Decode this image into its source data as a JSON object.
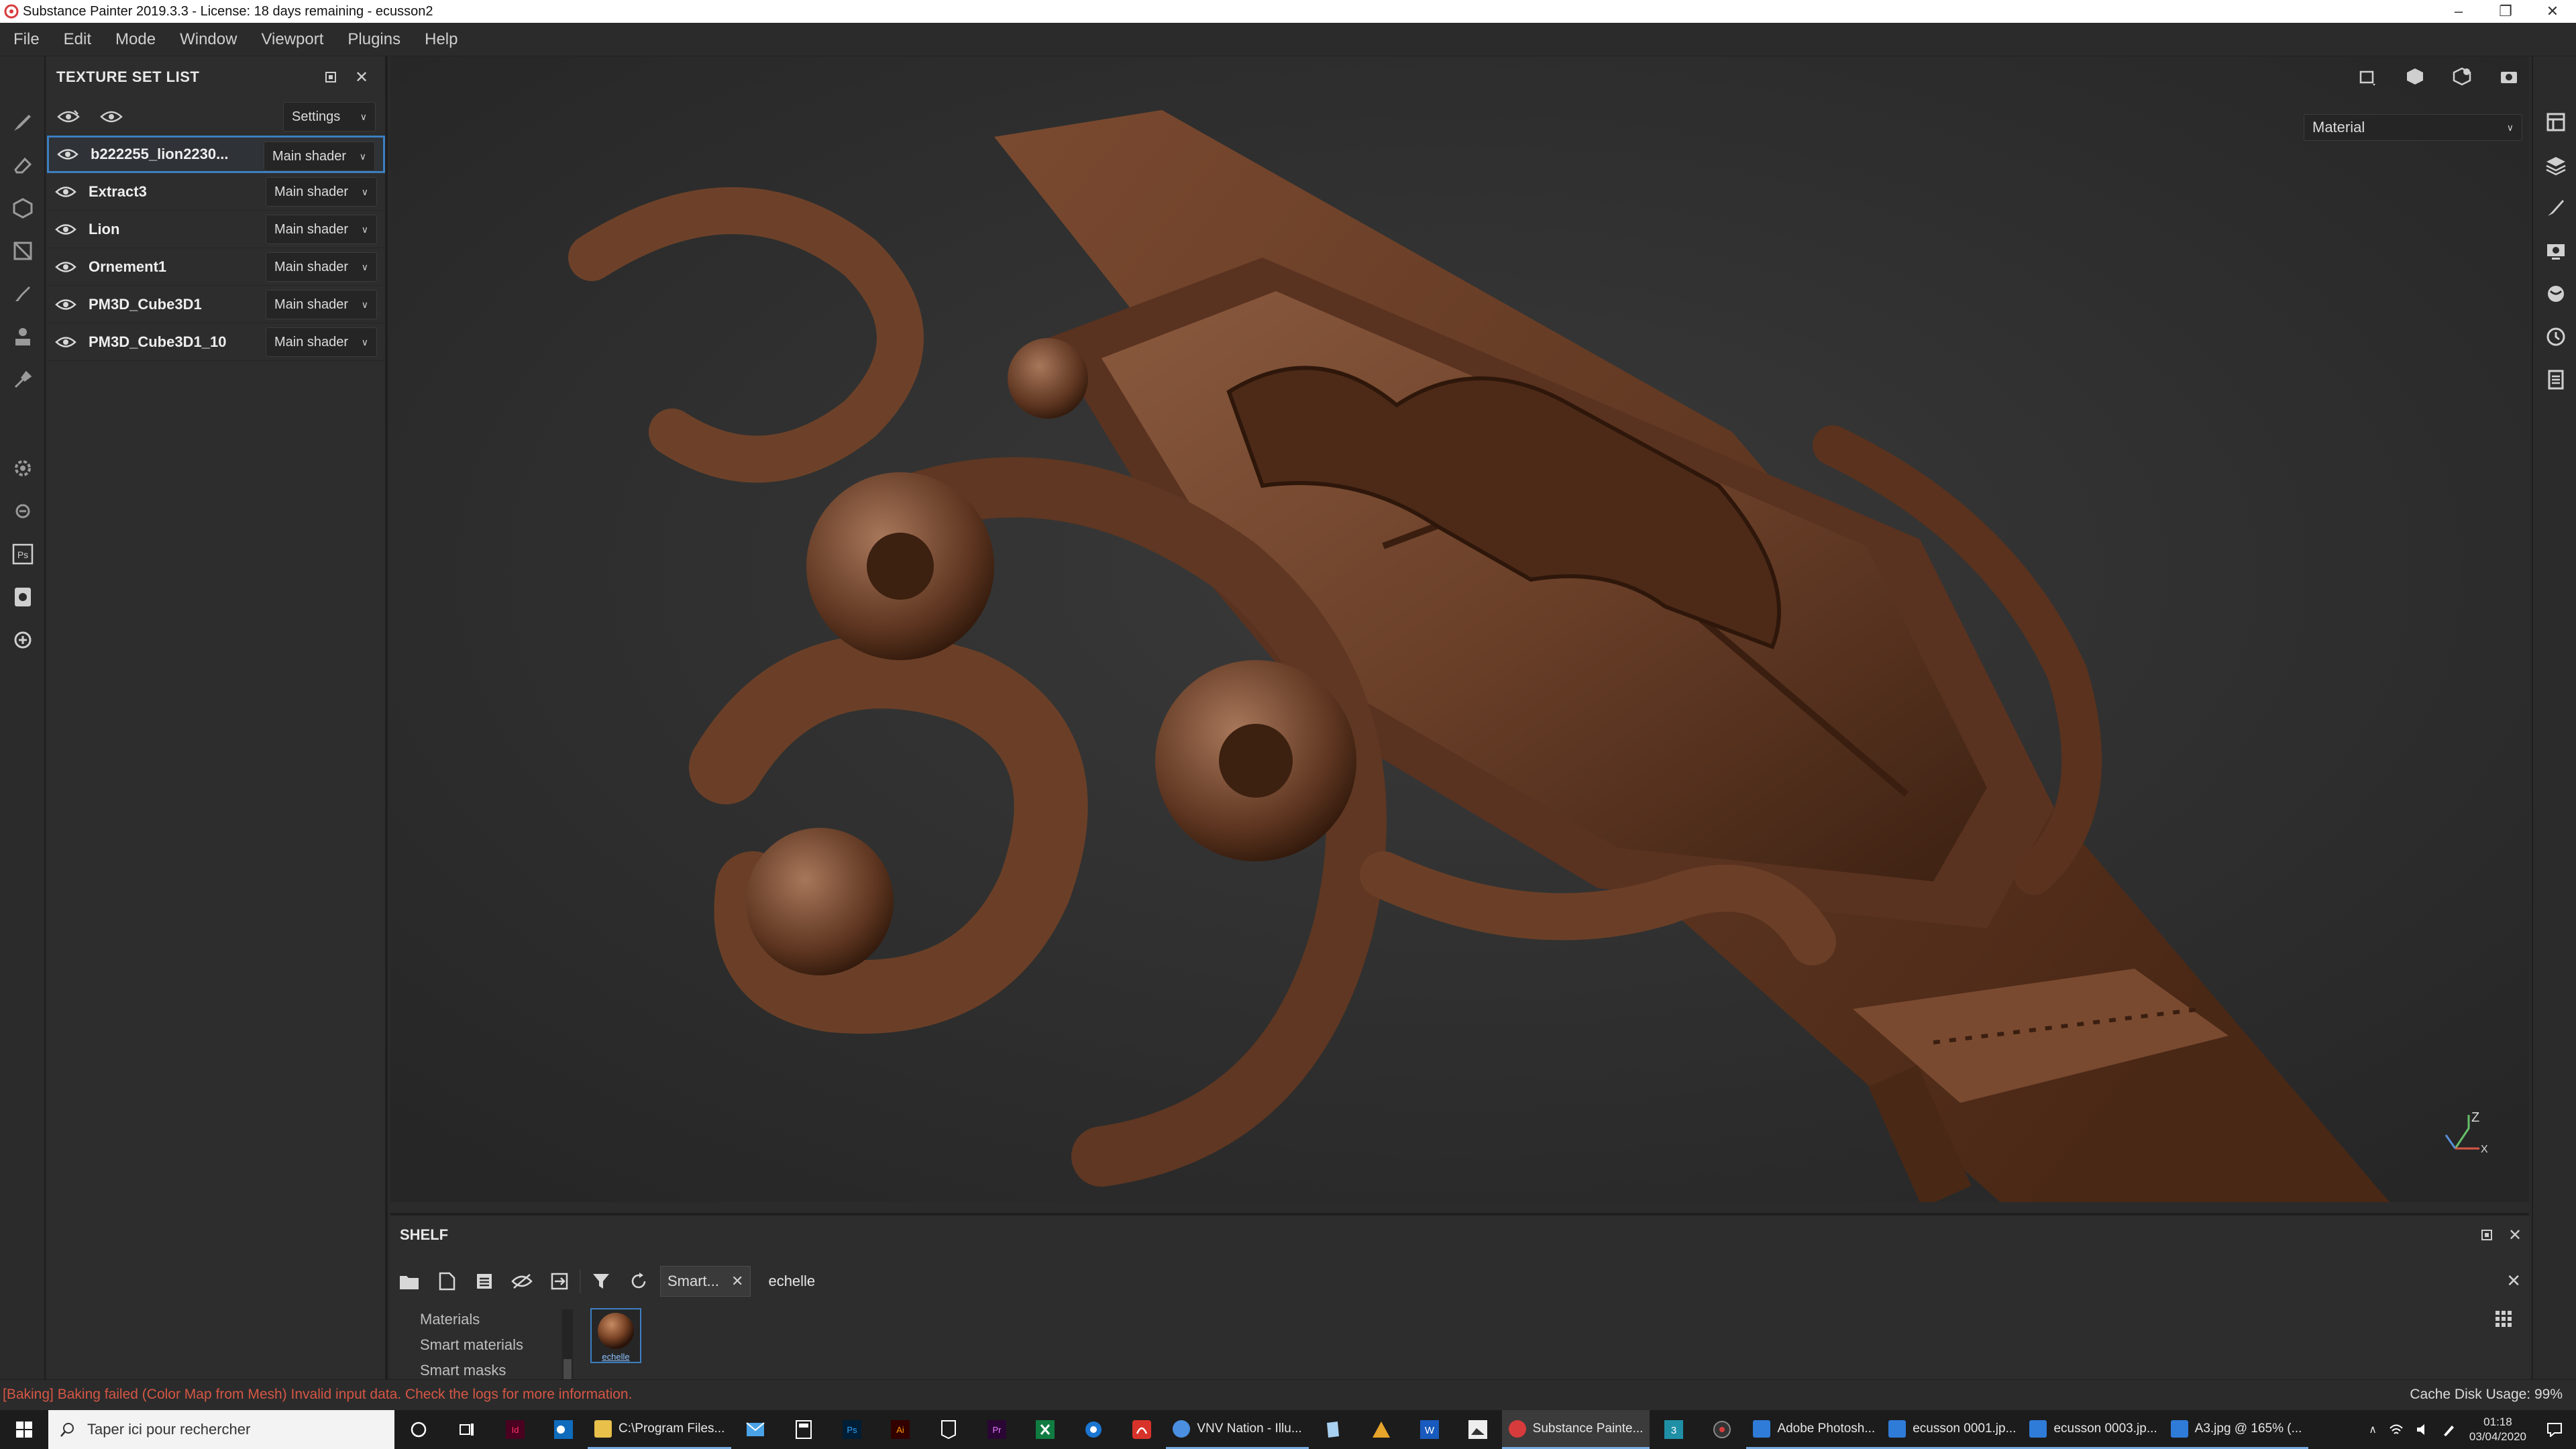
{
  "window": {
    "title": "Substance Painter 2019.3.3 - License: 18 days remaining - ecusson2",
    "controls": [
      "–",
      "❐",
      "✕"
    ]
  },
  "menu": [
    "File",
    "Edit",
    "Mode",
    "Window",
    "Viewport",
    "Plugins",
    "Help"
  ],
  "left_tools": [
    "paint-brush-icon",
    "eraser-icon",
    "projection-icon",
    "polygon-fill-icon",
    "smudge-icon",
    "clone-icon",
    "color-picker-icon",
    "settings-gear-icon",
    "bake-icon",
    "photoshop-export-icon",
    "iray-icon",
    "plugin-icon"
  ],
  "texture_set_list": {
    "title": "TEXTURE SET LIST",
    "settings_label": "Settings",
    "rows": [
      {
        "name": "b222255_lion2230...",
        "shader": "Main shader",
        "selected": true
      },
      {
        "name": "Extract3",
        "shader": "Main shader",
        "selected": false
      },
      {
        "name": "Lion",
        "shader": "Main shader",
        "selected": false
      },
      {
        "name": "Ornement1",
        "shader": "Main shader",
        "selected": false
      },
      {
        "name": "PM3D_Cube3D1",
        "shader": "Main shader",
        "selected": false
      },
      {
        "name": "PM3D_Cube3D1_10",
        "shader": "Main shader",
        "selected": false
      }
    ]
  },
  "viewport": {
    "display_mode": "Material",
    "axis_labels": {
      "z": "Z",
      "x": "X"
    }
  },
  "shelf": {
    "title": "SHELF",
    "filter_chip": "Smart...",
    "search_text": "echelle",
    "categories": [
      "Materials",
      "Smart materials",
      "Smart masks"
    ],
    "asset": {
      "label": "echelle"
    }
  },
  "status": {
    "message": "[Baking] Baking failed (Color Map from Mesh) Invalid input data. Check the logs for more information.",
    "cache": "Cache Disk Usage: 99%",
    "error_color": "#d65745"
  },
  "taskbar": {
    "search_placeholder": "Taper ici pour rechercher",
    "apps": [
      {
        "label": "C:\\Program Files...",
        "color": "#e8c04a"
      },
      {
        "label": "VNV Nation - Illu...",
        "color": "#4a8fe0"
      },
      {
        "label": "Substance Painte...",
        "color": "#d83b3b"
      },
      {
        "label": "Adobe Photosh...",
        "color": "#2f7bd8"
      },
      {
        "label": "ecusson 0001.jp...",
        "color": "#2f7bd8"
      },
      {
        "label": "ecusson 0003.jp...",
        "color": "#2f7bd8"
      },
      {
        "label": "A3.jpg @ 165% (...",
        "color": "#2f7bd8"
      }
    ],
    "time": "01:18",
    "date": "03/04/2020"
  }
}
